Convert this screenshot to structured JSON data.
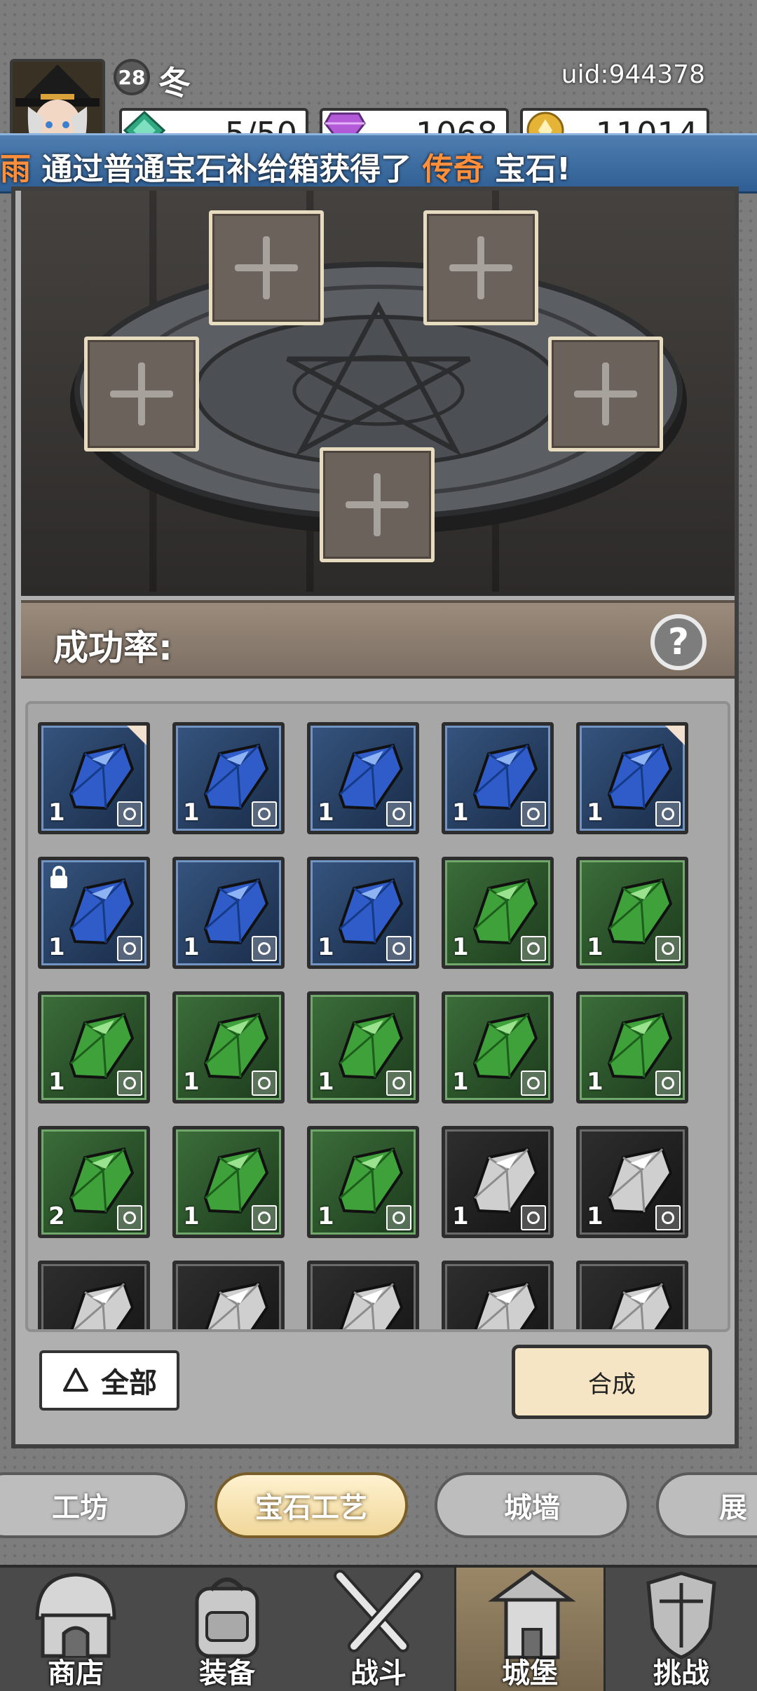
{
  "header": {
    "level": "28",
    "player_name": "冬",
    "uid": "uid:944378",
    "resources": [
      {
        "icon": "green-crystal-icon",
        "value": "5/50"
      },
      {
        "icon": "purple-diamond-icon",
        "value": "1068"
      },
      {
        "icon": "gold-coin-icon",
        "value": "11014"
      }
    ]
  },
  "ticker": {
    "prefix": "雨",
    "text_before": " 通过普通宝石补给箱获得了 ",
    "highlight": "传奇",
    "text_after": " 宝石!"
  },
  "forge": {
    "success_rate_label": "成功率:",
    "help_label": "?"
  },
  "inventory": {
    "items": [
      {
        "color": "blue",
        "qty": "1",
        "type": "boot",
        "marked": true,
        "locked": false
      },
      {
        "color": "blue",
        "qty": "1",
        "type": "boot",
        "marked": false,
        "locked": false
      },
      {
        "color": "blue",
        "qty": "1",
        "type": "boot",
        "marked": false,
        "locked": false
      },
      {
        "color": "blue",
        "qty": "1",
        "type": "wand",
        "marked": false,
        "locked": false
      },
      {
        "color": "blue",
        "qty": "1",
        "type": "helmet",
        "marked": true,
        "locked": false
      },
      {
        "color": "blue",
        "qty": "1",
        "type": "scroll",
        "marked": false,
        "locked": true
      },
      {
        "color": "blue",
        "qty": "1",
        "type": "scroll",
        "marked": false,
        "locked": false
      },
      {
        "color": "blue",
        "qty": "1",
        "type": "scroll",
        "marked": false,
        "locked": false
      },
      {
        "color": "green",
        "qty": "1",
        "type": "ring",
        "marked": false,
        "locked": false
      },
      {
        "color": "green",
        "qty": "1",
        "type": "boot",
        "marked": false,
        "locked": false
      },
      {
        "color": "green",
        "qty": "1",
        "type": "wand",
        "marked": false,
        "locked": false
      },
      {
        "color": "green",
        "qty": "1",
        "type": "helmet",
        "marked": false,
        "locked": false
      },
      {
        "color": "green",
        "qty": "1",
        "type": "helmet",
        "marked": false,
        "locked": false
      },
      {
        "color": "green",
        "qty": "1",
        "type": "helmet",
        "marked": false,
        "locked": false
      },
      {
        "color": "green",
        "qty": "1",
        "type": "helmet",
        "marked": false,
        "locked": false
      },
      {
        "color": "green",
        "qty": "2",
        "type": "scroll",
        "marked": false,
        "locked": false
      },
      {
        "color": "green",
        "qty": "1",
        "type": "scroll",
        "marked": false,
        "locked": false
      },
      {
        "color": "green",
        "qty": "1",
        "type": "scroll",
        "marked": false,
        "locked": false
      },
      {
        "color": "gray",
        "qty": "1",
        "type": "armor",
        "marked": false,
        "locked": false
      },
      {
        "color": "gray",
        "qty": "1",
        "type": "armor",
        "marked": false,
        "locked": false
      },
      {
        "color": "gray",
        "qty": "",
        "type": "",
        "marked": false,
        "locked": false
      },
      {
        "color": "gray",
        "qty": "",
        "type": "",
        "marked": false,
        "locked": false
      },
      {
        "color": "gray",
        "qty": "",
        "type": "",
        "marked": false,
        "locked": false
      },
      {
        "color": "gray",
        "qty": "",
        "type": "",
        "marked": false,
        "locked": false
      },
      {
        "color": "gray",
        "qty": "",
        "type": "",
        "marked": false,
        "locked": false
      }
    ]
  },
  "actions": {
    "all_filter": "全部",
    "combine": "合成"
  },
  "tabs": [
    "工坊",
    "宝石工艺",
    "城墙",
    "展"
  ],
  "active_tab": "宝石工艺",
  "nav": [
    {
      "label": "商店",
      "icon": "shop-hut-icon"
    },
    {
      "label": "装备",
      "icon": "backpack-icon"
    },
    {
      "label": "战斗",
      "icon": "crossed-swords-icon"
    },
    {
      "label": "城堡",
      "icon": "castle-tower-icon"
    },
    {
      "label": "挑战",
      "icon": "shield-crest-icon"
    }
  ],
  "active_nav": "城堡",
  "colors": {
    "ticker_highlight": "#ff8f3a",
    "ticker_bg": "#3a6aa0",
    "active_tab_bg": "#f6e5c4"
  }
}
